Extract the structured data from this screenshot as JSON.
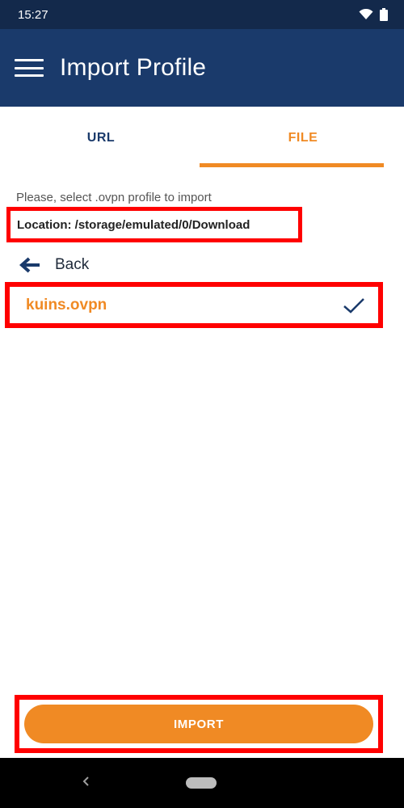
{
  "status_bar": {
    "time": "15:27",
    "icons": [
      "wifi-icon",
      "battery-icon"
    ]
  },
  "app_bar": {
    "title": "Import Profile",
    "menu_icon": "hamburger-menu-icon"
  },
  "tabs": [
    {
      "label": "URL",
      "active": false
    },
    {
      "label": "FILE",
      "active": true
    }
  ],
  "file_picker": {
    "instruction": "Please, select .ovpn profile to import",
    "location": "Location: /storage/emulated/0/Download",
    "back_label": "Back",
    "files": [
      {
        "name": "kuins.ovpn",
        "selected": true
      }
    ]
  },
  "import_button": {
    "label": "IMPORT"
  },
  "colors": {
    "app_bar": "#1a3a6b",
    "status_bar": "#13294b",
    "accent": "#f08a24",
    "highlight": "#ff0000"
  }
}
